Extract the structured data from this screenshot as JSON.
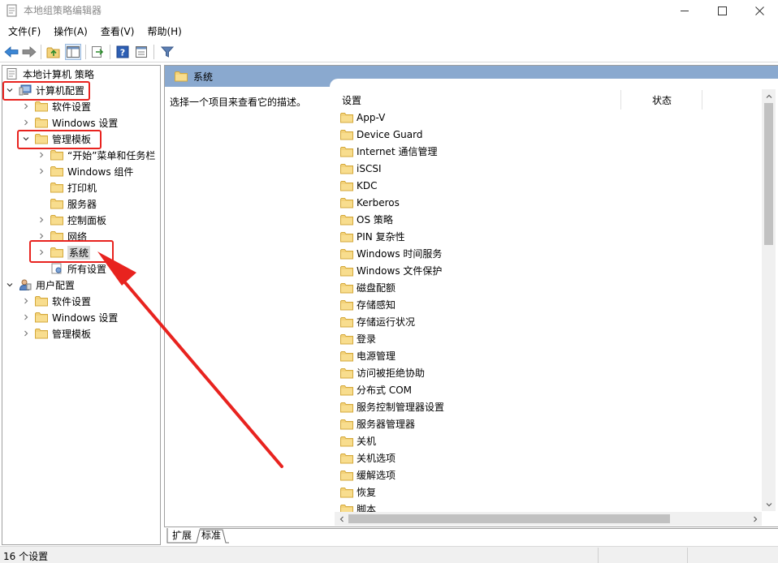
{
  "window": {
    "title": "本地组策略编辑器"
  },
  "menu": [
    "文件(F)",
    "操作(A)",
    "查看(V)",
    "帮助(H)"
  ],
  "toolbar_icons": [
    "back-arrow-icon",
    "forward-arrow-icon",
    "up-folder-icon",
    "show-hide-tree-icon",
    "export-list-icon",
    "help-icon",
    "properties-icon",
    "filter-icon"
  ],
  "tree": {
    "root": "本地计算机 策略",
    "computer_config": "计算机配置",
    "c_software": "软件设置",
    "c_windows": "Windows 设置",
    "admin_templates": "管理模板",
    "start_menu": "“开始”菜单和任务栏",
    "windows_components": "Windows 组件",
    "printers": "打印机",
    "servers": "服务器",
    "control_panel": "控制面板",
    "network": "网络",
    "system": "系统",
    "all_settings": "所有设置",
    "user_config": "用户配置",
    "u_software": "软件设置",
    "u_windows": "Windows 设置",
    "u_admin": "管理模板"
  },
  "right": {
    "header": "系统",
    "description": "选择一个项目来查看它的描述。",
    "col_setting": "设置",
    "col_state": "状态",
    "items": [
      "App-V",
      "Device Guard",
      "Internet 通信管理",
      "iSCSI",
      "KDC",
      "Kerberos",
      "OS 策略",
      "PIN 复杂性",
      "Windows 时间服务",
      "Windows 文件保护",
      "磁盘配额",
      "存储感知",
      "存储运行状况",
      "登录",
      "电源管理",
      "访问被拒绝协助",
      "分布式 COM",
      "服务控制管理器设置",
      "服务器管理器",
      "关机",
      "关机选项",
      "缓解选项",
      "恢复",
      "脚本"
    ]
  },
  "tabs": [
    "扩展",
    "标准"
  ],
  "status": "16 个设置",
  "colors": {
    "header_blue": "#8aa9cf",
    "annotation_red": "#e8231f",
    "folder_yellow": "#f3d27a"
  }
}
